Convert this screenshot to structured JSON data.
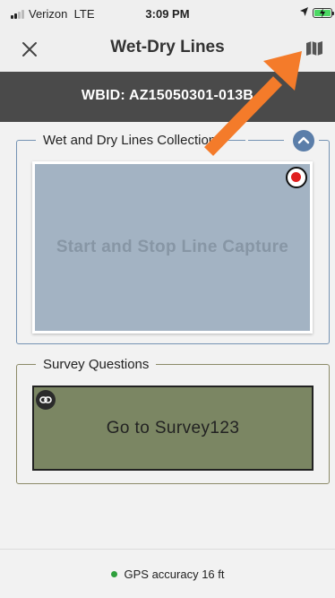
{
  "status_bar": {
    "carrier": "Verizon",
    "network": "LTE",
    "time": "3:09 PM"
  },
  "nav": {
    "title": "Wet-Dry Lines",
    "close_icon": "close-icon",
    "map_icon": "map-icon"
  },
  "wbid": {
    "text": "WBID: AZ15050301-013B"
  },
  "collection": {
    "legend": "Wet and Dry Lines Collection",
    "capture_label": "Start and Stop Line Capture",
    "collapse_icon": "chevron-up-icon",
    "record_icon": "record-icon"
  },
  "survey": {
    "legend": "Survey Questions",
    "button_label": "Go to Survey123",
    "link_icon": "link-icon"
  },
  "footer": {
    "gps_text": "GPS accuracy 16 ft"
  },
  "colors": {
    "header_dark": "#4a4a4a",
    "capture_bg": "#a3b3c3",
    "survey_bg": "#7b8663",
    "accent_blue": "#5b7ea9",
    "record_red": "#e01f1f",
    "gps_green": "#2e9f3c",
    "annotation_orange": "#f47b2a"
  }
}
